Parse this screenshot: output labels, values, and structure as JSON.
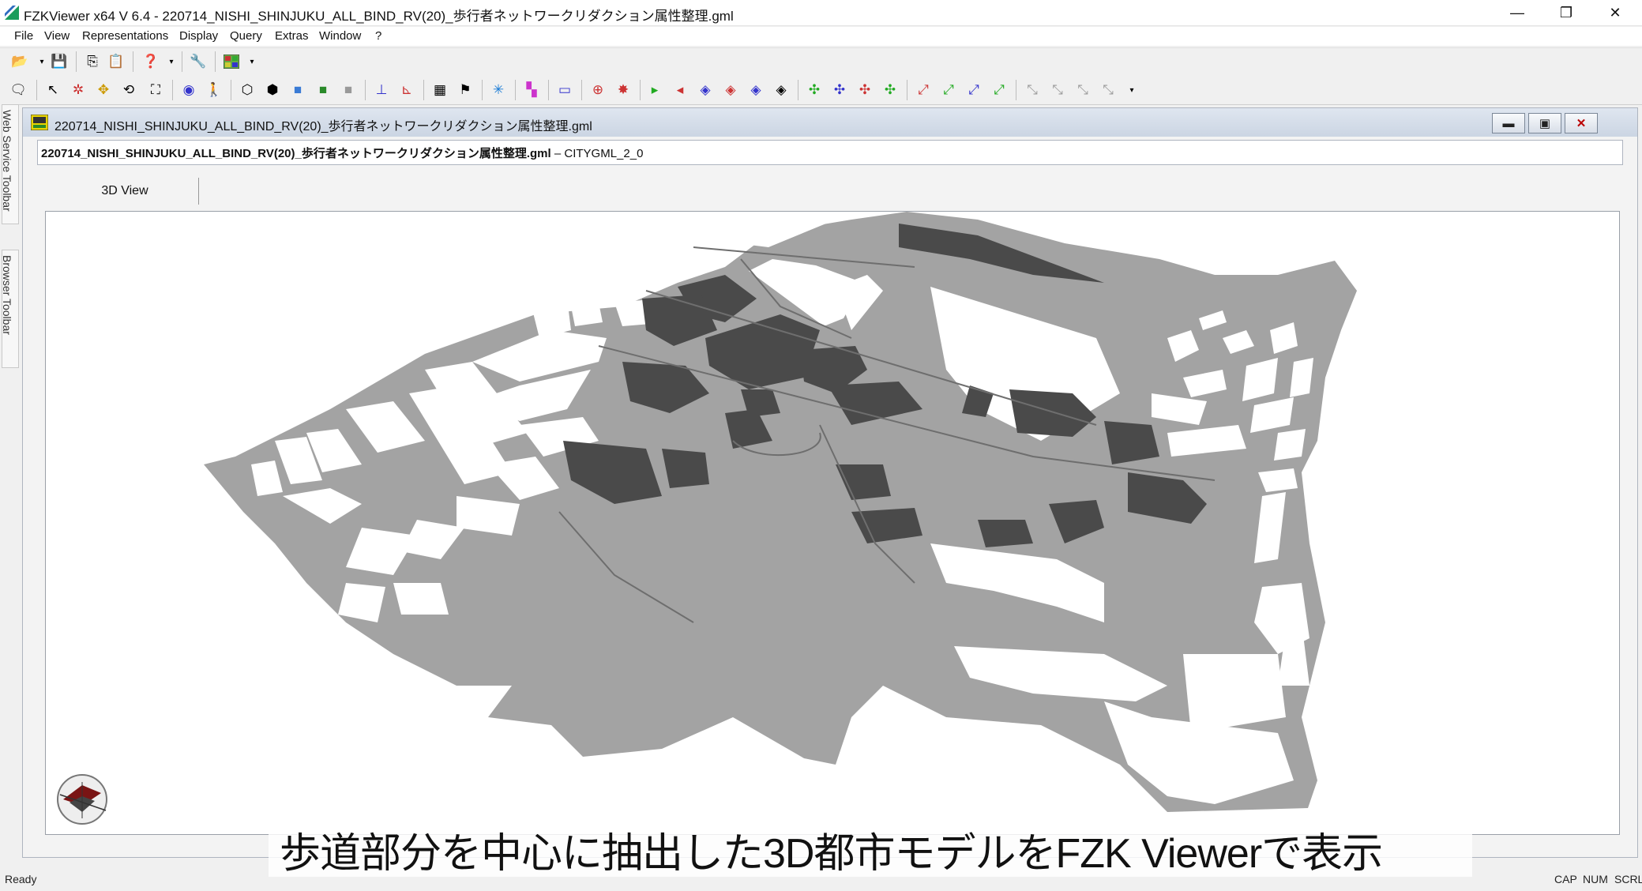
{
  "window": {
    "title": "FZKViewer x64 V 6.4 - 220714_NISHI_SHINJUKU_ALL_BIND_RV(20)_歩行者ネットワークリダクション属性整理.gml",
    "minimize": "—",
    "restore": "❐",
    "close": "✕"
  },
  "menu": [
    "File",
    "View",
    "Representations",
    "Display",
    "Query",
    "Extras",
    "Window",
    "?"
  ],
  "left_tabs": [
    "Web Service Toolbar",
    "Browser Toolbar"
  ],
  "child_window": {
    "title": "220714_NISHI_SHINJUKU_ALL_BIND_RV(20)_歩行者ネットワークリダクション属性整理.gml",
    "file_name": "220714_NISHI_SHINJUKU_ALL_BIND_RV(20)_歩行者ネットワークリダクション属性整理.gml",
    "file_format": " – CITYGML_2_0",
    "tab": "3D View"
  },
  "status": {
    "ready": "Ready",
    "cap": "CAP",
    "num": "NUM",
    "scrl": "SCRL"
  },
  "caption": "歩道部分を中心に抽出した3D都市モデルをFZK Viewerで表示",
  "colors": {
    "ground": "#a3a3a3",
    "building": "#4a4a4a",
    "accent_icon": "#1a9c5b"
  }
}
